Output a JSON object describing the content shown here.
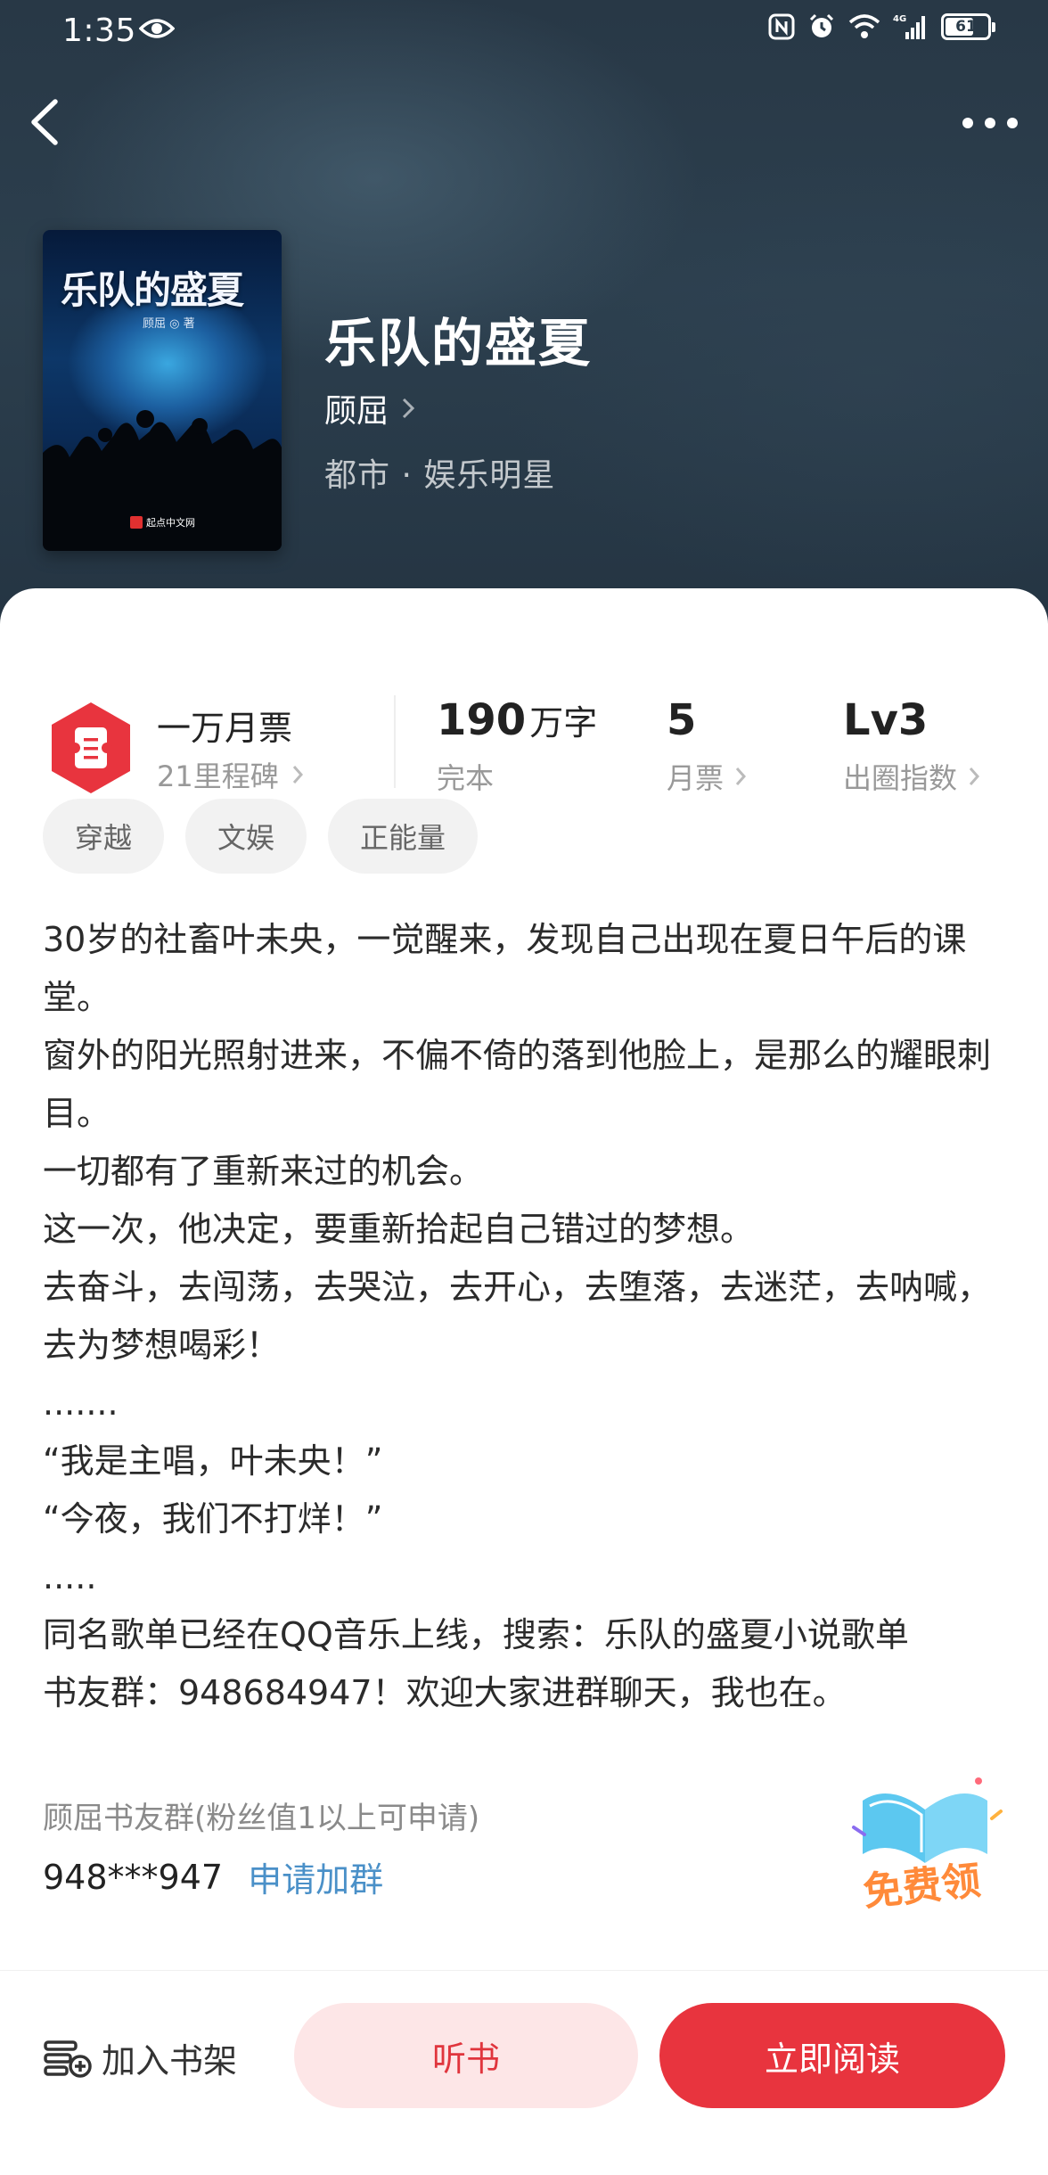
{
  "status_bar": {
    "time": "1:35",
    "battery_level": "61",
    "battery_fraction": 0.61,
    "network": "4G"
  },
  "book": {
    "title": "乐队的盛夏",
    "author": "顾屈",
    "genre": "都市 · 娱乐明星",
    "cover": {
      "title": "乐队的盛夏",
      "author_line": "顾屈 ◎ 著",
      "publisher": "起点中文网"
    }
  },
  "stats": {
    "ticket": {
      "main": "一万月票",
      "sub": "21里程碑"
    },
    "words": {
      "value": "190",
      "unit": "万字",
      "label": "完本"
    },
    "monthly": {
      "value": "5",
      "label": "月票"
    },
    "index": {
      "value": "Lv3",
      "label": "出圈指数"
    }
  },
  "tags": [
    "穿越",
    "文娱",
    "正能量"
  ],
  "description": [
    "30岁的社畜叶未央，一觉醒来，发现自己出现在夏日午后的课堂。",
    "窗外的阳光照射进来，不偏不倚的落到他脸上，是那么的耀眼刺目。",
    "一切都有了重新来过的机会。",
    "这一次，他决定，要重新拾起自己错过的梦想。",
    "去奋斗，去闯荡，去哭泣，去开心，去堕落，去迷茫，去呐喊，去为梦想喝彩！",
    ".......",
    "“我是主唱，叶未央！”",
    "“今夜，我们不打烊！”",
    ".....",
    "同名歌单已经在QQ音乐上线，搜索：乐队的盛夏小说歌单",
    "书友群：948684947！欢迎大家进群聊天，我也在。"
  ],
  "group": {
    "name": "顾屈书友群(粉丝值1以上可申请)",
    "number": "948***947",
    "join_label": "申请加群"
  },
  "promo": {
    "label": "免费领"
  },
  "bottom_bar": {
    "shelf_label": "加入书架",
    "listen_label": "听书",
    "read_label": "立即阅读"
  },
  "colors": {
    "accent_red": "#e8343e",
    "listen_bg": "#fde6e7",
    "link_blue": "#4a90c8",
    "hero_bg": "#2a3b49"
  },
  "icons": [
    "eye-icon",
    "nfc-icon",
    "alarm-icon",
    "wifi-icon",
    "signal-icon",
    "battery-icon",
    "back-arrow-icon",
    "more-dots-icon",
    "ticket-icon",
    "chevron-right-icon",
    "book-open-icon",
    "bookshelf-add-icon"
  ]
}
